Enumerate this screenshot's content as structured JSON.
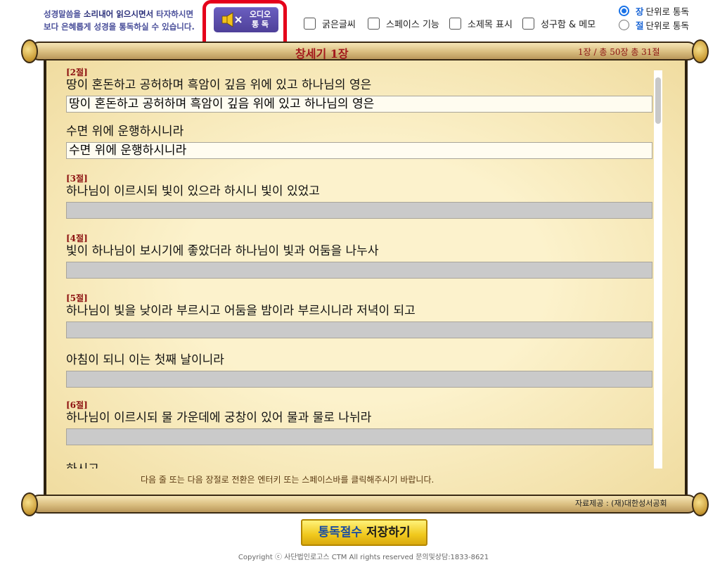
{
  "intro": {
    "line1_a": "성경말씀을 ",
    "line1_b": "소리내어 읽으시면서",
    "line1_c": " 타자하시면",
    "line2": "보다 은혜롭게 성경을 통독하실 수 있습니다."
  },
  "audio_button": {
    "line1": "오디오",
    "line2": "통  독",
    "icon": "speaker-mute-icon"
  },
  "options": {
    "bold": "굵은글씨",
    "space": "스페이스 기능",
    "subtitle": "소제목 표시",
    "memo": "성구함 & 메모"
  },
  "read_mode": {
    "chapter_accent": "장",
    "chapter_rest": "단위로 통독",
    "verse_accent": "절",
    "verse_rest": "단위로 통독",
    "selected": "chapter"
  },
  "header": {
    "title": "창세기 1장",
    "count": "1장 / 총 50장   총 31절"
  },
  "verses": [
    {
      "num": "[2절]",
      "text": "땅이 혼돈하고 공허하며 흑암이 깊음 위에 있고 하나님의 영은",
      "typed": "땅이 혼돈하고 공허하며 흑암이 깊음 위에 있고 하나님의 영은"
    },
    {
      "num": "",
      "text": "수면 위에 운행하시니라",
      "typed": "수면 위에 운행하시니라"
    },
    {
      "num": "[3절]",
      "text": "하나님이 이르시되 빛이 있으라 하시니 빛이 있었고",
      "typed": ""
    },
    {
      "num": "[4절]",
      "text": "빛이 하나님이 보시기에 좋았더라 하나님이 빛과 어둠을 나누사",
      "typed": ""
    },
    {
      "num": "[5절]",
      "text": "하나님이 빛을 낮이라 부르시고 어둠을 밤이라 부르시니라 저녁이 되고",
      "typed": ""
    },
    {
      "num": "",
      "text": "아침이 되니 이는 첫째 날이니라",
      "typed": ""
    },
    {
      "num": "[6절]",
      "text": "하나님이 이르시되 물 가운데에 궁창이 있어 물과 물로 나뉘라",
      "typed": ""
    }
  ],
  "cut_text": "하시고",
  "hint": "다음 줄 또는 다음 장절로 전환은 엔터키 또는 스페이스바를 클릭해주시기 바랍니다.",
  "credit": "자료제공 : (재)대한성서공회",
  "save_button": {
    "part1": "통독절수",
    "part2": " 저장하기"
  },
  "copyright": "Copyright ⓒ 사단법인로고스 CTM All rights reserved 문의및상담:1833-8621",
  "colors": {
    "accent_red": "#e5001b",
    "audio_purple": "#5a4fb0",
    "verse_num": "#8c1010",
    "parchment": "#f6e8b3"
  }
}
